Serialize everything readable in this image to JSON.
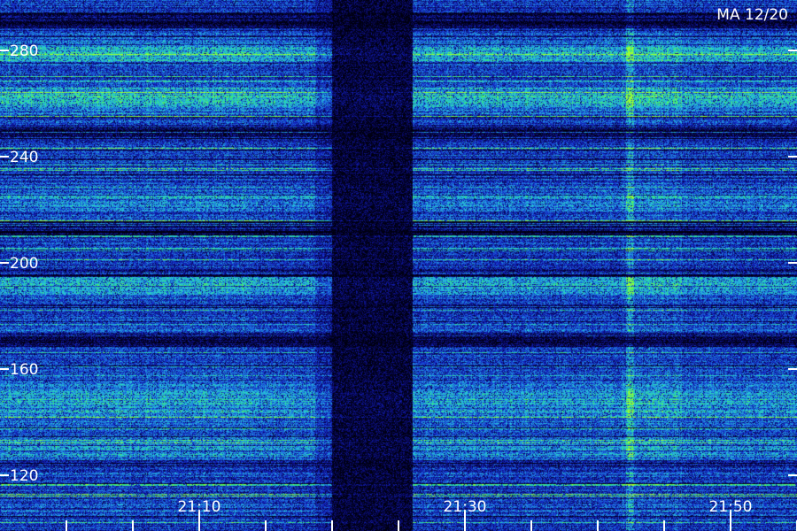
{
  "chart_data": {
    "type": "heatmap",
    "title": "MA 12/20",
    "y_ticks": [
      {
        "value": 280,
        "label": "280"
      },
      {
        "value": 240,
        "label": "240"
      },
      {
        "value": 200,
        "label": "200"
      },
      {
        "value": 160,
        "label": "160"
      },
      {
        "value": 120,
        "label": "120"
      }
    ],
    "x_tick_labels": [
      {
        "time": "21:10",
        "label": "21:10"
      },
      {
        "time": "21:30",
        "label": "21:30"
      },
      {
        "time": "21:50",
        "label": "21:50"
      }
    ],
    "x_minor_tick_times": [
      "21:00",
      "21:05",
      "21:10",
      "21:15",
      "21:20",
      "21:25",
      "21:30",
      "21:35",
      "21:40",
      "21:45",
      "21:50",
      "21:55"
    ],
    "y_range": [
      108,
      292
    ],
    "x_range": [
      "20:55",
      "21:55"
    ],
    "quiet_time_band": [
      "21:20",
      "21:26"
    ],
    "colormap": [
      "#000010",
      "#0a0a6e",
      "#1428c8",
      "#1e78dc",
      "#28c8dc",
      "#32e678",
      "#a0ff32"
    ],
    "background_color": "#000010",
    "grid": false
  }
}
